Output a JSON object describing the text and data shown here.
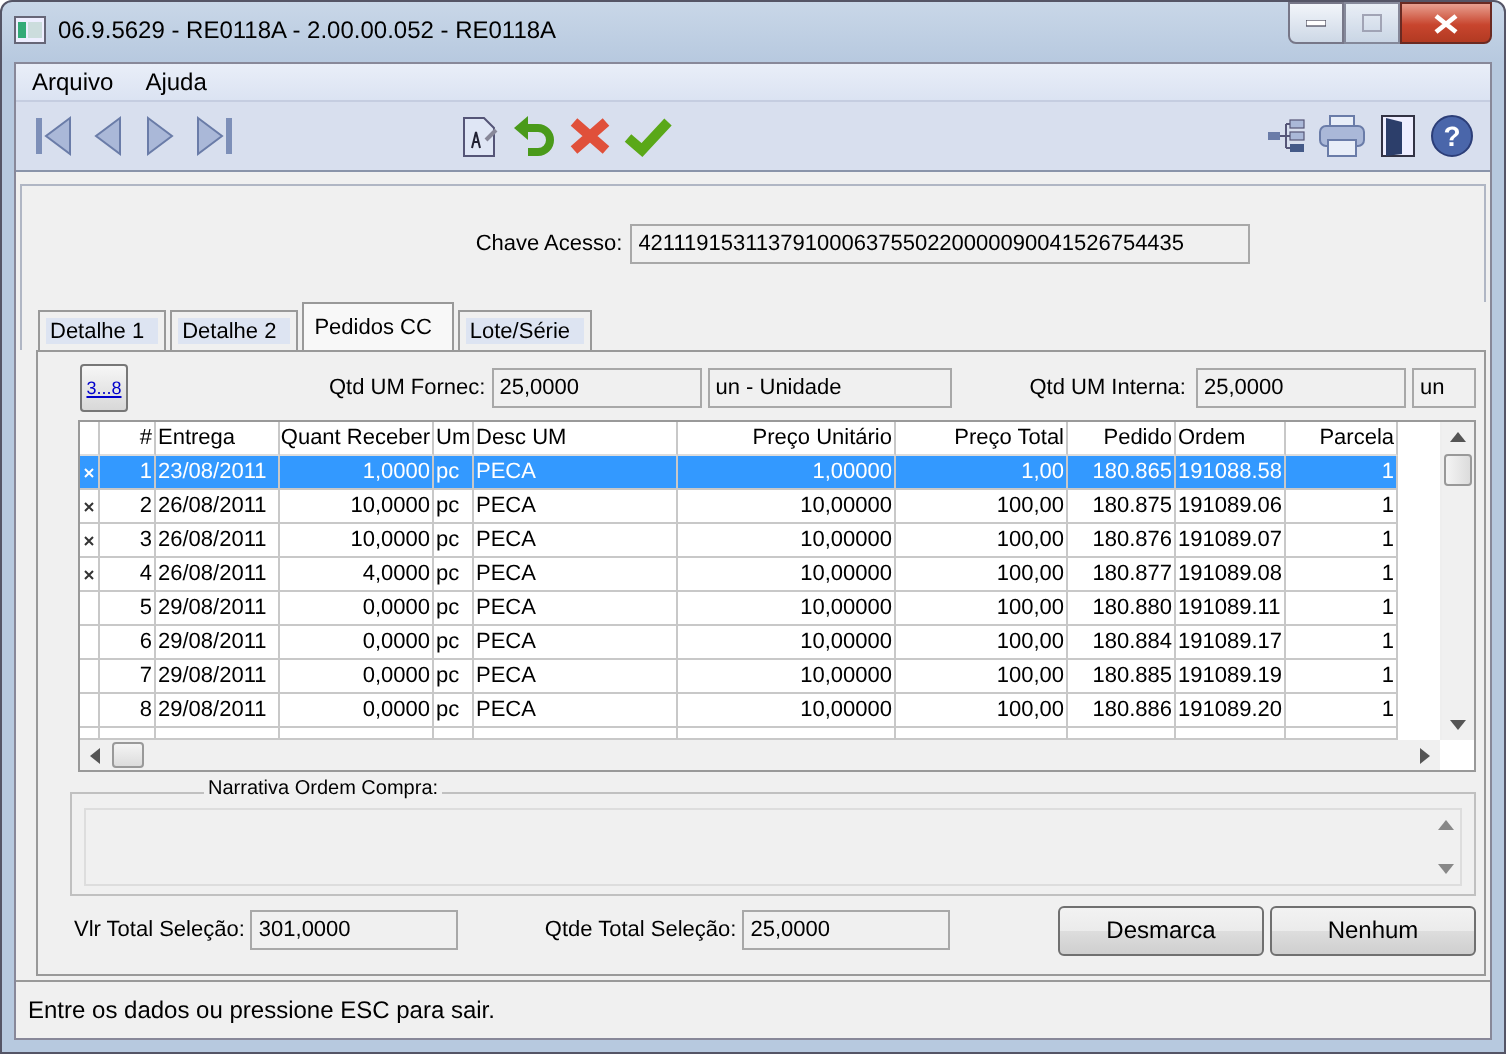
{
  "window": {
    "title": "06.9.5629 - RE0118A - 2.00.00.052 - RE0118A"
  },
  "menu": [
    "Arquivo",
    "Ajuda"
  ],
  "access_key": {
    "label": "Chave Acesso:",
    "value": "421119153113791000637550220000090041526754435"
  },
  "toolbar": {
    "help_glyph": "?"
  },
  "tabs": [
    {
      "label": "Detalhe 1",
      "selected": false
    },
    {
      "label": "Detalhe 2",
      "selected": false
    },
    {
      "label": "Pedidos CC",
      "selected": true
    },
    {
      "label": "Lote/Série",
      "selected": false
    }
  ],
  "range_button": {
    "label": "3...8"
  },
  "qtd_fornec": {
    "label": "Qtd UM Fornec:",
    "value": "25,0000",
    "unit": "un - Unidade"
  },
  "qtd_interna": {
    "label": "Qtd UM Interna:",
    "value": "25,0000",
    "unit": "un"
  },
  "table": {
    "columns": [
      "#",
      "Entrega",
      "Quant Receber",
      "Um",
      "Desc UM",
      "Preço Unitário",
      "Preço Total",
      "Pedido",
      "Ordem",
      "Parcela"
    ],
    "rows": [
      {
        "marked": true,
        "selected": true,
        "cells": [
          "1",
          "23/08/2011",
          "1,0000",
          "pc",
          "PECA",
          "1,00000",
          "1,00",
          "180.865",
          "191088.58",
          "1"
        ]
      },
      {
        "marked": true,
        "selected": false,
        "cells": [
          "2",
          "26/08/2011",
          "10,0000",
          "pc",
          "PECA",
          "10,00000",
          "100,00",
          "180.875",
          "191089.06",
          "1"
        ]
      },
      {
        "marked": true,
        "selected": false,
        "cells": [
          "3",
          "26/08/2011",
          "10,0000",
          "pc",
          "PECA",
          "10,00000",
          "100,00",
          "180.876",
          "191089.07",
          "1"
        ]
      },
      {
        "marked": true,
        "selected": false,
        "cells": [
          "4",
          "26/08/2011",
          "4,0000",
          "pc",
          "PECA",
          "10,00000",
          "100,00",
          "180.877",
          "191089.08",
          "1"
        ]
      },
      {
        "marked": false,
        "selected": false,
        "cells": [
          "5",
          "29/08/2011",
          "0,0000",
          "pc",
          "PECA",
          "10,00000",
          "100,00",
          "180.880",
          "191089.11",
          "1"
        ]
      },
      {
        "marked": false,
        "selected": false,
        "cells": [
          "6",
          "29/08/2011",
          "0,0000",
          "pc",
          "PECA",
          "10,00000",
          "100,00",
          "180.884",
          "191089.17",
          "1"
        ]
      },
      {
        "marked": false,
        "selected": false,
        "cells": [
          "7",
          "29/08/2011",
          "0,0000",
          "pc",
          "PECA",
          "10,00000",
          "100,00",
          "180.885",
          "191089.19",
          "1"
        ]
      },
      {
        "marked": false,
        "selected": false,
        "cells": [
          "8",
          "29/08/2011",
          "0,0000",
          "pc",
          "PECA",
          "10,00000",
          "100,00",
          "180.886",
          "191089.20",
          "1"
        ]
      }
    ]
  },
  "narrative": {
    "label": "Narrativa Ordem Compra:"
  },
  "totals": [
    {
      "label": "Vlr Total Seleção:",
      "value": "301,0000"
    },
    {
      "label": "Qtde Total Seleção:",
      "value": "25,0000"
    }
  ],
  "buttons": [
    "Desmarca",
    "Nenhum"
  ],
  "status_bar": "Entre os dados ou pressione ESC para sair."
}
